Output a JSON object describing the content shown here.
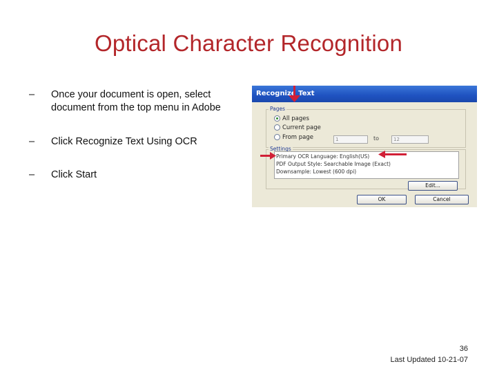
{
  "slide": {
    "title": "Optical Character Recognition",
    "bullets": [
      {
        "dash": "–",
        "text": "Once your document is open, select document from the top menu in Adobe"
      },
      {
        "dash": "–",
        "text": "Click Recognize Text Using OCR"
      },
      {
        "dash": "–",
        "text": "Click Start"
      }
    ],
    "page_number": "36",
    "last_updated": "Last Updated 10-21-07"
  },
  "dialog": {
    "title": "Recognize Text",
    "pages_label": "Pages",
    "options": [
      "All pages",
      "Current page",
      "From page"
    ],
    "selected_option": "All pages",
    "from_value": "1",
    "to_label": "to",
    "to_value": "12",
    "settings_label": "Settings",
    "settings_lines": [
      "Primary OCR Language: English(US)",
      "PDF Output Style: Searchable Image (Exact)",
      "Downsample: Lowest (600 dpi)"
    ],
    "edit_button": "Edit...",
    "ok_button": "OK",
    "cancel_button": "Cancel"
  },
  "colors": {
    "title": "#b3262a",
    "arrow": "#d11f36",
    "dialog_bg": "#ece9d8",
    "titlebar": "#1f52c0"
  }
}
